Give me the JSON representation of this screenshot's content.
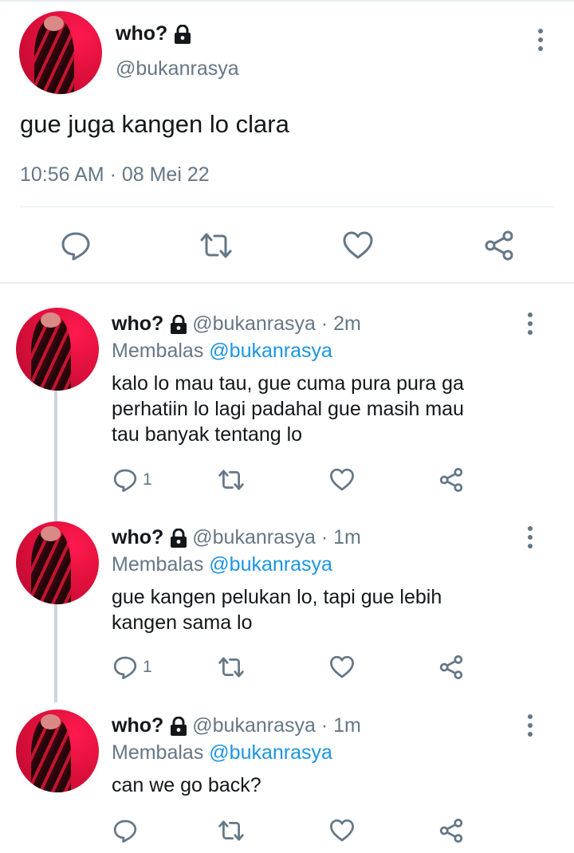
{
  "main_tweet": {
    "display_name": "who?",
    "handle": "@bukanrasya",
    "text": "gue juga kangen lo clara",
    "timestamp": "10:56 AM · 08 Mei 22",
    "icons": [
      "lock-icon",
      "more-vert-icon",
      "reply-icon",
      "retweet-icon",
      "like-icon",
      "share-icon"
    ]
  },
  "replies": [
    {
      "display_name": "who?",
      "meta": "@bukanrasya · 2m",
      "replying_prefix": "Membalas",
      "replying_to": "@bukanrasya",
      "text_lines": [
        "kalo lo mau tau, gue cuma pura pura ga",
        "perhatiin lo lagi padahal gue masih mau",
        "tau banyak tentang lo"
      ],
      "reply_count": "1"
    },
    {
      "display_name": "who?",
      "meta": "@bukanrasya · 1m",
      "replying_prefix": "Membalas",
      "replying_to": "@bukanrasya",
      "text_lines": [
        "gue kangen pelukan lo, tapi gue lebih",
        "kangen sama lo"
      ],
      "reply_count": "1"
    },
    {
      "display_name": "who?",
      "meta": "@bukanrasya · 1m",
      "replying_prefix": "Membalas",
      "replying_to": "@bukanrasya",
      "text_lines": [
        "can we go back?"
      ],
      "reply_count": ""
    }
  ],
  "colors": {
    "text": "#14171a",
    "secondary": "#657786",
    "mention": "#1b95e0",
    "divider": "#e1e8ed",
    "thread_line": "#ccd6dd",
    "avatar_red": "#e0103c"
  }
}
